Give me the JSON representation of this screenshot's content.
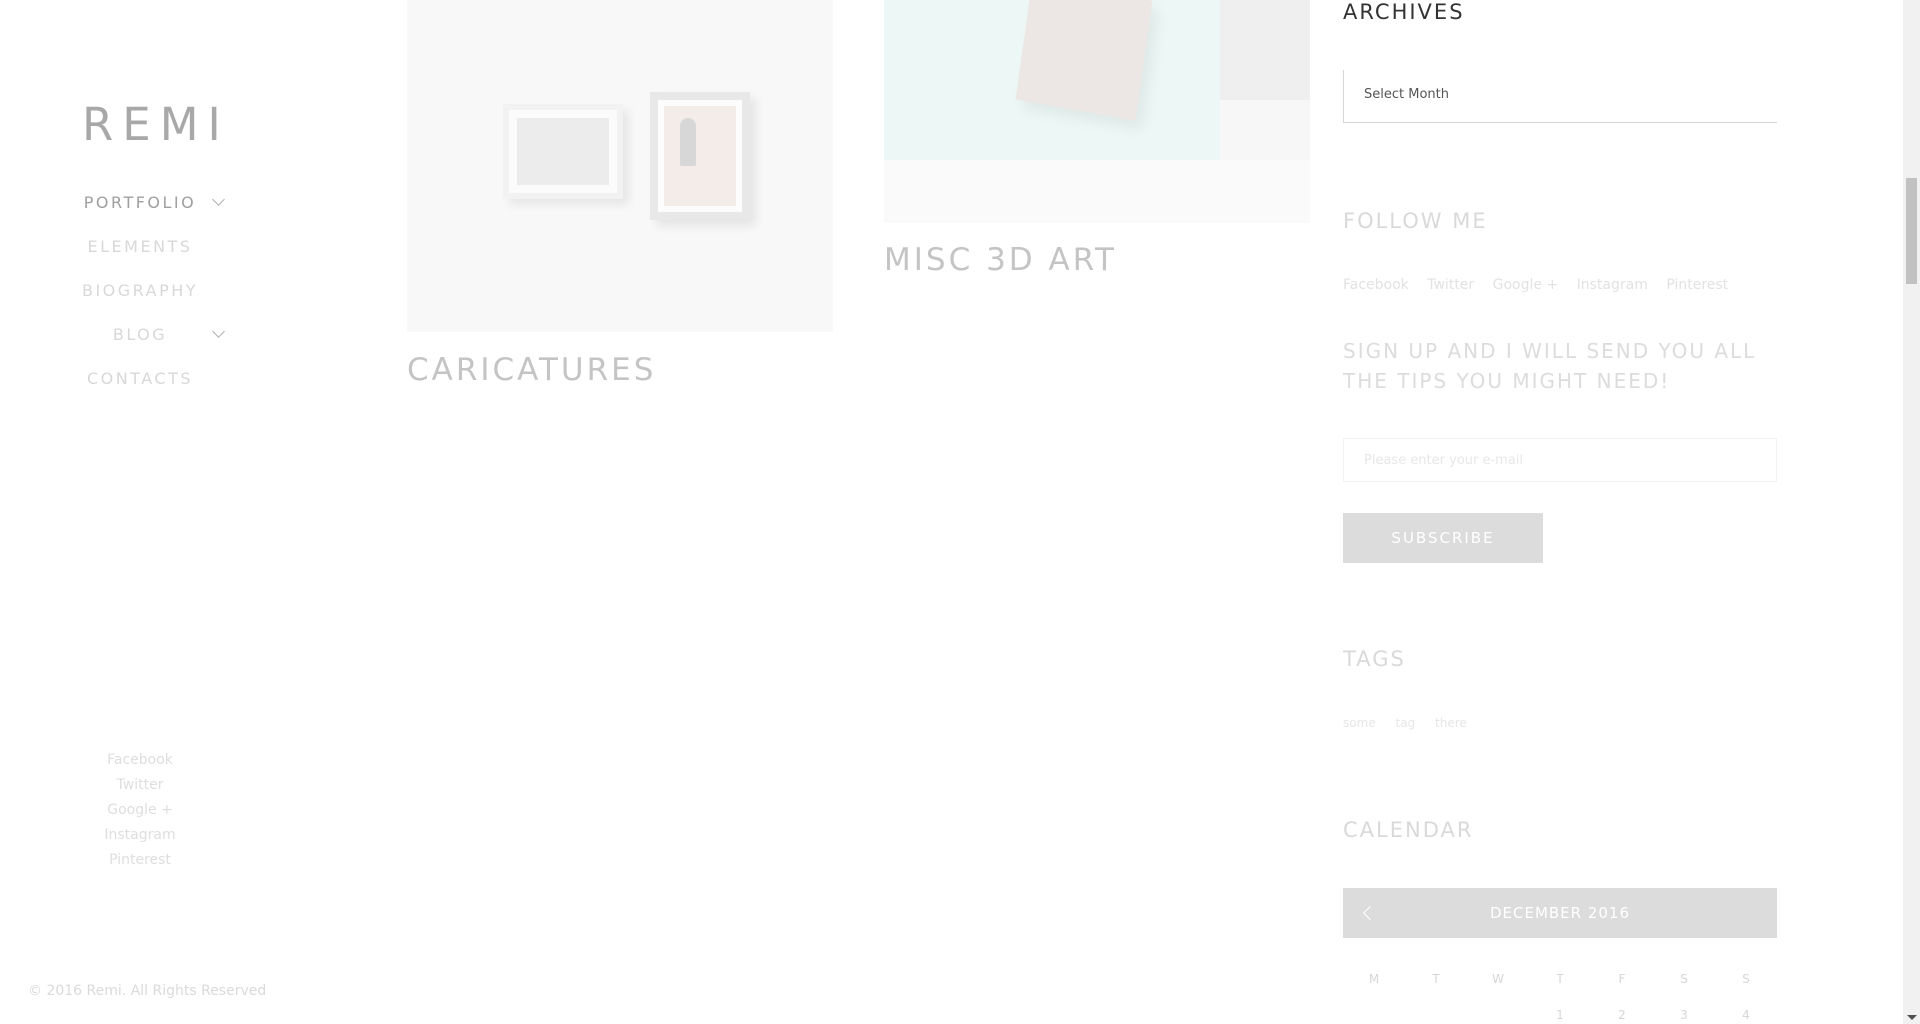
{
  "sidebar": {
    "logo": "REMI",
    "nav": [
      {
        "label": "PORTFOLIO"
      },
      {
        "label": "ELEMENTS"
      },
      {
        "label": "BIOGRAPHY"
      },
      {
        "label": "BLOG"
      },
      {
        "label": "CONTACTS"
      }
    ],
    "social": [
      "Facebook",
      "Twitter",
      "Google +",
      "Instagram",
      "Pinterest"
    ],
    "copyright": "© 2016 Remi. All Rights Reserved"
  },
  "portfolio": {
    "items": [
      {
        "title": "CARICATURES"
      },
      {
        "title": "MISC 3D ART"
      }
    ]
  },
  "widgets": {
    "archives": {
      "title": "ARCHIVES",
      "select_value": "Select Month"
    },
    "follow": {
      "title": "FOLLOW ME",
      "links": [
        "Facebook",
        "Twitter",
        "Google +",
        "Instagram",
        "Pinterest"
      ]
    },
    "signup": {
      "title": "SIGN UP AND I WILL SEND YOU ALL THE TIPS YOU MIGHT NEED!",
      "placeholder": "Please enter your e-mail",
      "button": "SUBSCRIBE"
    },
    "tags": {
      "title": "TAGS",
      "items": [
        "some",
        "tag",
        "there"
      ]
    },
    "calendar": {
      "title": "CALENDAR",
      "month": "DECEMBER 2016",
      "weekdays": [
        "M",
        "T",
        "W",
        "T",
        "F",
        "S",
        "S"
      ],
      "first_row": [
        "",
        "",
        "",
        "1",
        "2",
        "3",
        "4"
      ]
    }
  },
  "colors": {
    "accent_grey": "#dcdcdc"
  }
}
